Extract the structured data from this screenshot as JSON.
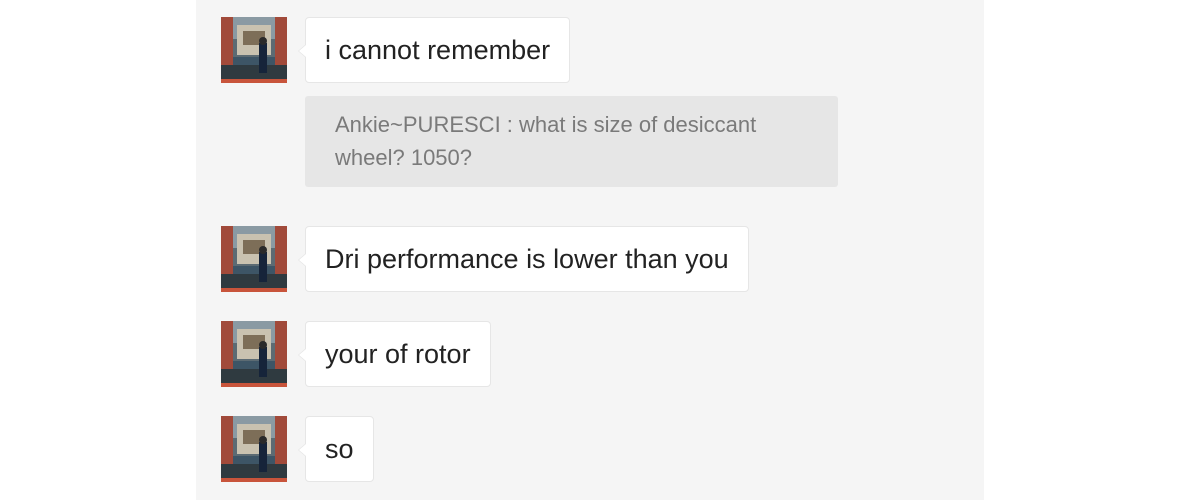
{
  "messages": [
    {
      "avatar_icon": "user-photo-avatar",
      "text": "i cannot remember"
    },
    {
      "avatar_icon": "user-photo-avatar",
      "text": "Dri performance is lower than you"
    },
    {
      "avatar_icon": "user-photo-avatar",
      "text": "your of rotor"
    },
    {
      "avatar_icon": "user-photo-avatar",
      "text": "so"
    }
  ],
  "quote": {
    "text": "Ankie~PURESCI : what is size of desiccant wheel? 1050?"
  },
  "colors": {
    "panel_bg": "#f5f5f5",
    "bubble_bg": "#ffffff",
    "quote_bg": "#e6e6e6",
    "quote_text": "#7a7a7a",
    "message_text": "#222222"
  }
}
